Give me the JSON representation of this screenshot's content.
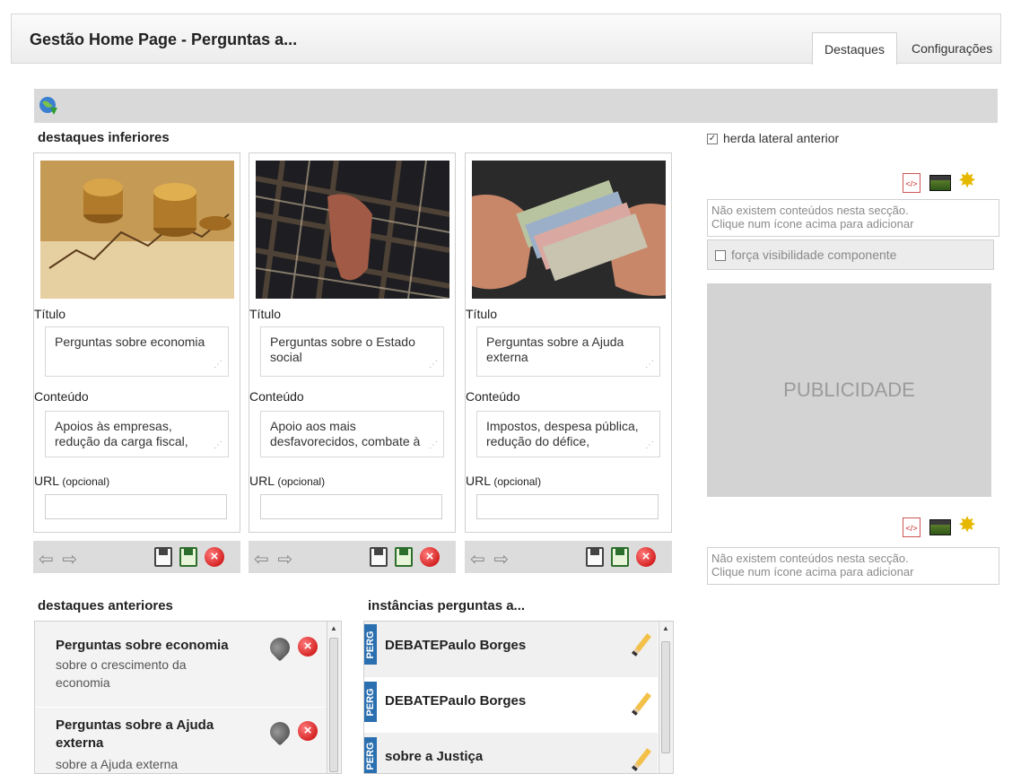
{
  "header": {
    "title": "Gestão Home Page - Perguntas a...",
    "tabs": [
      {
        "label": "Destaques"
      },
      {
        "label": "Configurações"
      }
    ]
  },
  "sections": {
    "destaques_inferiores": "destaques inferiores",
    "destaques_anteriores": "destaques anteriores",
    "instancias": "instâncias perguntas a..."
  },
  "cards": [
    {
      "titulo_label": "Título",
      "titulo": "Perguntas sobre economia",
      "conteudo_label": "Conteúdo",
      "conteudo": "Apoios às empresas, redução da carga fiscal,",
      "url_label": "URL",
      "url_hint": "(opcional)",
      "url_value": ""
    },
    {
      "titulo_label": "Título",
      "titulo": "Perguntas sobre o Estado social",
      "conteudo_label": "Conteúdo",
      "conteudo": "Apoio aos mais desfavorecidos, combate à",
      "url_label": "URL",
      "url_hint": "(opcional)",
      "url_value": ""
    },
    {
      "titulo_label": "Título",
      "titulo": "Perguntas sobre a Ajuda externa",
      "conteudo_label": "Conteúdo",
      "conteudo": "Impostos, despesa pública, redução do défice,",
      "url_label": "URL",
      "url_hint": "(opcional)",
      "url_value": ""
    }
  ],
  "actionbar": {
    "arrows": "⇦ ⇨"
  },
  "right": {
    "herda_label": "herda lateral anterior",
    "empty_line1": "Não existem conteúdos nesta secção.",
    "empty_line2": "Clique num ícone acima para adicionar",
    "forca_label": "força visibilidade componente",
    "publicidade": "PUBLICIDADE",
    "code_glyph": "</>"
  },
  "anteriores": [
    {
      "title": "Perguntas sobre economia",
      "desc": "sobre o crescimento da economia"
    },
    {
      "title": "Perguntas sobre a Ajuda externa",
      "desc": "sobre a Ajuda externa"
    }
  ],
  "instancias": [
    {
      "tag": "PERG",
      "title": "DEBATEPaulo Borges"
    },
    {
      "tag": "PERG",
      "title": "DEBATEPaulo Borges"
    },
    {
      "tag": "PERG",
      "title": "sobre a Justiça"
    }
  ],
  "colors": {
    "tag_blue": "#2a6fb0",
    "toolbar_grey": "#d9d9d9",
    "publicidade_bg": "#d3d3d3"
  }
}
